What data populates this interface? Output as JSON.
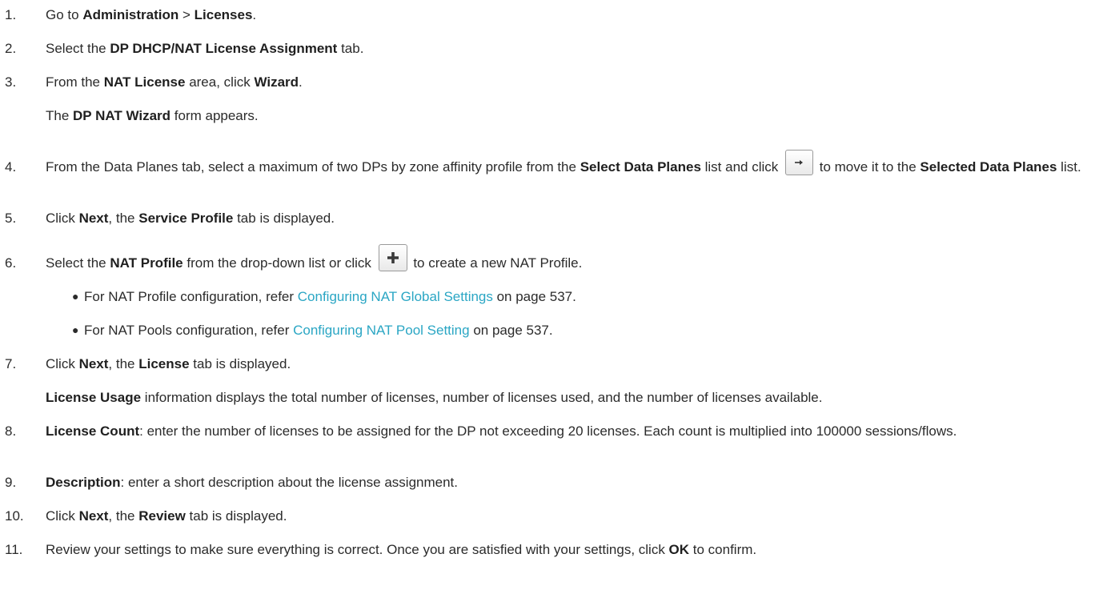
{
  "steps": [
    {
      "n": "1.",
      "t1": "Go to ",
      "b1": "Administration",
      "t2": " > ",
      "b2": "Licenses",
      "t3": "."
    },
    {
      "n": "2.",
      "t1": "Select the ",
      "b1": "DP DHCP/NAT License Assignment",
      "t2": " tab."
    },
    {
      "n": "3.",
      "t1": "From the ",
      "b1": "NAT License",
      "t2": " area, click ",
      "b2": "Wizard",
      "t3": ".",
      "note_pre": "The ",
      "note_b": "DP NAT Wizard",
      "note_post": " form appears."
    },
    {
      "n": "4.",
      "t1": "From the Data Planes tab, select a maximum of two DPs by zone affinity profile from the ",
      "b1": "Select Data Planes",
      "t2": " list and click ",
      "t3": " to move it to the ",
      "b2": "Selected Data Planes",
      "t4": " list.",
      "icon": "arrow-right-icon"
    },
    {
      "n": "5.",
      "t1": "Click ",
      "b1": "Next",
      "t2": ", the ",
      "b2": "Service Profile",
      "t3": " tab is displayed."
    },
    {
      "n": "6.",
      "t1": "Select the ",
      "b1": "NAT Profile",
      "t2": " from the drop-down list or click ",
      "t3": " to create a new NAT Profile.",
      "icon": "plus-icon",
      "bullets": [
        {
          "bullet": "●",
          "pre": "For NAT Profile configuration, refer ",
          "link": "Configuring NAT Global Settings",
          "post": " on page 537."
        },
        {
          "bullet": "●",
          "pre": "For NAT Pools configuration, refer ",
          "link": "Configuring NAT Pool Setting",
          "post": " on page 537."
        }
      ]
    },
    {
      "n": "7.",
      "t1": "Click ",
      "b1": "Next",
      "t2": ", the ",
      "b2": "License",
      "t3": " tab is displayed.",
      "note_b": "License Usage",
      "note_post": " information displays the total number of licenses, number of licenses used, and the number of licenses available."
    },
    {
      "n": "8.",
      "b1": "License Count",
      "t1": ": enter the number of licenses to be assigned for the DP not exceeding 20 licenses. Each count is multiplied into 100000 sessions/flows."
    },
    {
      "n": "9.",
      "b1": "Description",
      "t1": ": enter a short description about the license assignment."
    },
    {
      "n": "10.",
      "t1": "Click ",
      "b1": "Next",
      "t2": ", the ",
      "b2": "Review",
      "t3": " tab is displayed."
    },
    {
      "n": "11.",
      "t1": "Review your settings to make sure everything is correct. Once you are satisfied with your settings, click ",
      "b1": "OK",
      "t2": " to confirm."
    }
  ]
}
